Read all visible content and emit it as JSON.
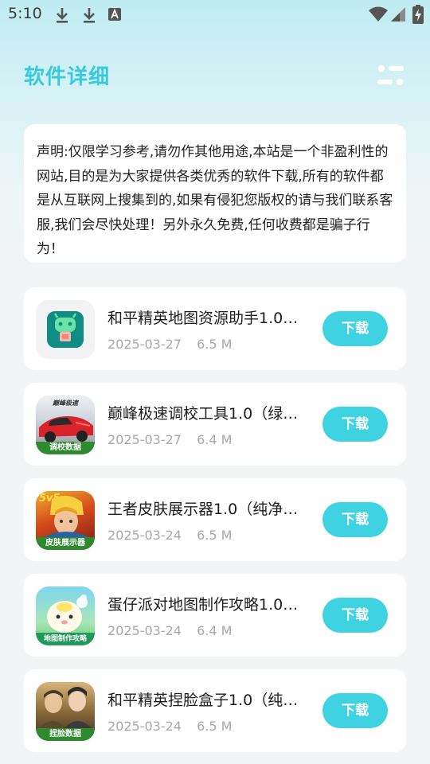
{
  "status": {
    "time": "5:10"
  },
  "header": {
    "title": "软件详细"
  },
  "notice": {
    "text": "声明:仅限学习参考,请勿作其他用途,本站是一个非盈利性的网站,目的是为大家提供各类优秀的软件下载,所有的软件都是从互联网上搜集到的,如果有侵犯您版权的请与我们联系客服,我们会尽快处理！另外永久免费,任何收费都是骗子行为！"
  },
  "apps": [
    {
      "name": "和平精英地图资源助手1.0…",
      "date": "2025-03-27",
      "size": "6.5 M",
      "button": "下载",
      "icon": "green-robot-app-icon"
    },
    {
      "name": "巅峰极速调校工具1.0（绿…",
      "date": "2025-03-27",
      "size": "6.4 M",
      "button": "下载",
      "icon": "racing-car-app-icon",
      "icon_banner": "调校数据",
      "icon_top": "巅峰极速"
    },
    {
      "name": "王者皮肤展示器1.0（纯净…",
      "date": "2025-03-24",
      "size": "6.5 M",
      "button": "下载",
      "icon": "hero-skin-app-icon",
      "icon_banner": "皮肤展示器",
      "icon_top": "5v5"
    },
    {
      "name": "蛋仔派对地图制作攻略1.0…",
      "date": "2025-03-24",
      "size": "6.4 M",
      "button": "下载",
      "icon": "egg-party-app-icon",
      "icon_banner": "地图制作攻略"
    },
    {
      "name": "和平精英捏脸盒子1.0（纯…",
      "date": "2025-03-24",
      "size": "6.5 M",
      "button": "下载",
      "icon": "soldier-face-app-icon",
      "icon_banner": "捏脸数据"
    }
  ]
}
